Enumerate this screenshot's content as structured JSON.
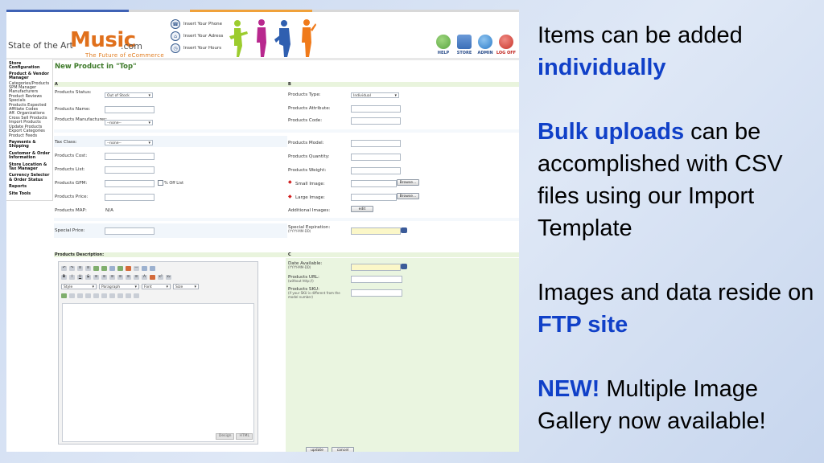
{
  "colors": {
    "accent_blue": "#1040c8",
    "header_stripes": [
      "#3f62b5",
      "#d8d8d8",
      "#f0a13a",
      "#d8d8d8"
    ],
    "logo_music": "#e0701c",
    "title_green": "#3e7a2a"
  },
  "header": {
    "logo_prefix": "State of the Art",
    "logo_main": "Music",
    "logo_suffix": ".com",
    "tagline": "The Future of eCommerce",
    "contact": [
      {
        "icon": "phone-icon",
        "text": "Insert Your Phone"
      },
      {
        "icon": "home-icon",
        "text": "Insert Your Adress"
      },
      {
        "icon": "clock-icon",
        "text": "Insert Your Hours"
      }
    ],
    "nav": [
      {
        "label": "HELP",
        "icon": "help-icon",
        "color": "#5aa640"
      },
      {
        "label": "STORE",
        "icon": "store-icon",
        "color": "#3c6fb8"
      },
      {
        "label": "ADMIN",
        "icon": "admin-icon",
        "color": "#2d7cc9"
      },
      {
        "label": "LOG OFF",
        "icon": "logoff-icon",
        "color": "#c8352c"
      }
    ]
  },
  "sidebar": {
    "items": [
      {
        "label": "Store Configuration",
        "bold": true
      },
      {
        "label": "Product & Vendor Manager",
        "bold": true
      },
      {
        "label": "Categories/Products",
        "bold": false
      },
      {
        "label": "SPM Manager",
        "bold": false
      },
      {
        "label": "Manufacturers",
        "bold": false
      },
      {
        "label": "Product Reviews",
        "bold": false
      },
      {
        "label": "Specials",
        "bold": false
      },
      {
        "label": "Products Expected",
        "bold": false
      },
      {
        "label": "Affiliate Codes",
        "bold": false
      },
      {
        "label": "Aff. Organizations",
        "bold": false
      },
      {
        "label": "Cross Sell Products",
        "bold": false
      },
      {
        "label": "Import Products",
        "bold": false
      },
      {
        "label": "Update Products",
        "bold": false
      },
      {
        "label": "Export Categories",
        "bold": false
      },
      {
        "label": "Product Feeds",
        "bold": false
      },
      {
        "label": "Payments & Shipping",
        "bold": true
      },
      {
        "label": "Customer & Order Information",
        "bold": true
      },
      {
        "label": "Store Location & Tax Manager",
        "bold": true
      },
      {
        "label": "Currency Selector & Order Status",
        "bold": true
      },
      {
        "label": "Reports",
        "bold": true
      },
      {
        "label": "Site Tools",
        "bold": true
      }
    ]
  },
  "form": {
    "title": "New Product in \"Top\"",
    "section_a": "A",
    "section_b": "B",
    "section_c": "C",
    "products_status_label": "Products Status:",
    "products_status_value": "Out of Stock",
    "products_name_label": "Products Name:",
    "products_manufacturer_label": "Products Manufacturer:",
    "products_manufacturer_value": "--none--",
    "products_type_label": "Products Type:",
    "products_type_value": "Individual",
    "products_attribute_label": "Products Attribute:",
    "products_code_label": "Products Code:",
    "tax_class_label": "Tax Class:",
    "tax_class_value": "--none--",
    "products_cost_label": "Products Cost:",
    "products_list_label": "Products List:",
    "products_gpm_label": "Products GPM:",
    "pct_off_list": "% Off List",
    "products_price_label": "Products Price:",
    "products_map_label": "Products MAP:",
    "products_map_value": "N/A",
    "products_model_label": "Products Model:",
    "products_quantity_label": "Products Quantity:",
    "products_weight_label": "Products Weight:",
    "small_image_label": "Small Image:",
    "large_image_label": "Large Image:",
    "browse_label": "Browse...",
    "additional_images_label": "Additional Images:",
    "edit_label": "edit",
    "special_price_label": "Special Price:",
    "special_expiration_label": "Special Expiration:",
    "date_format": "(YYYY-MM-DD)",
    "products_description_label": "Products Description:",
    "date_available_label": "Date Available:",
    "products_url_label": "Products URL:",
    "products_url_hint": "(without http://)",
    "products_sku_label": "Products SKU:",
    "products_sku_hint": "(if your SKU is different from the model number)",
    "update_label": "update",
    "cancel_label": "cancel"
  },
  "editor": {
    "style_label": "Style",
    "paragraph_label": "Paragraph",
    "font_label": "Font",
    "size_label": "Size",
    "design_label": "Design",
    "html_label": "HTML"
  },
  "notes": {
    "p1_a": "Items can be added",
    "p1_b": "individually",
    "p2_a": "Bulk uploads",
    "p2_b": " can be accomplished with CSV files using our Import Template",
    "p3_a": "Images and data reside on ",
    "p3_b": "FTP site",
    "p4_a": "NEW!",
    "p4_b": "  Multiple Image Gallery now available!"
  }
}
